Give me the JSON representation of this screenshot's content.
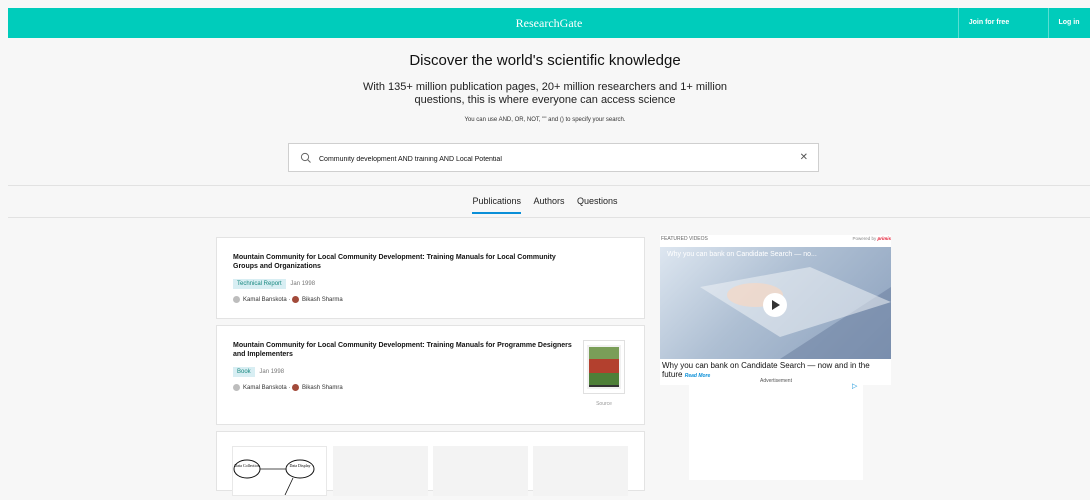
{
  "header": {
    "brand": "ResearchGate",
    "join_label": "Join for free",
    "login_label": "Log in",
    "accent_color": "#00ccbb"
  },
  "hero": {
    "title": "Discover the world's scientific knowledge",
    "subtitle": "With 135+ million publication pages, 20+ million researchers and 1+ million questions, this is where everyone can access science",
    "hint": "You can use AND, OR, NOT, \"\" and () to specify your search."
  },
  "search": {
    "value": "Community development AND training AND Local Potential",
    "icon": "search-icon",
    "clear_glyph": "✕"
  },
  "tabs": [
    {
      "label": "Publications",
      "active": true
    },
    {
      "label": "Authors",
      "active": false
    },
    {
      "label": "Questions",
      "active": false
    }
  ],
  "results": [
    {
      "title": "Mountain Community for Local Community Development: Training Manuals for Local Community Groups and Organizations",
      "type": "Technical Report",
      "date": "Jan 1998",
      "authors": [
        "Kamal Banskota",
        "Bikash Sharma"
      ]
    },
    {
      "title": "Mountain Community for Local Community Development: Training Manuals for Programme Designers and Implementers",
      "type": "Book",
      "date": "Jan 1998",
      "authors": [
        "Kamal Banskota",
        "Bikash Shamra"
      ],
      "source_label": "Source"
    }
  ],
  "figure_diagram": {
    "node1": "Data Collection",
    "node2": "Data Display"
  },
  "video": {
    "featured_label": "FEATURED VIDEOS",
    "powered_by": "Powered by",
    "provider": "primis",
    "player_title": "Why you can bank on Candidate Search — no...",
    "caption": "Why you can bank on Candidate Search — now and in the future",
    "read_more": "Read More",
    "advertisement_label": "Advertisement"
  }
}
